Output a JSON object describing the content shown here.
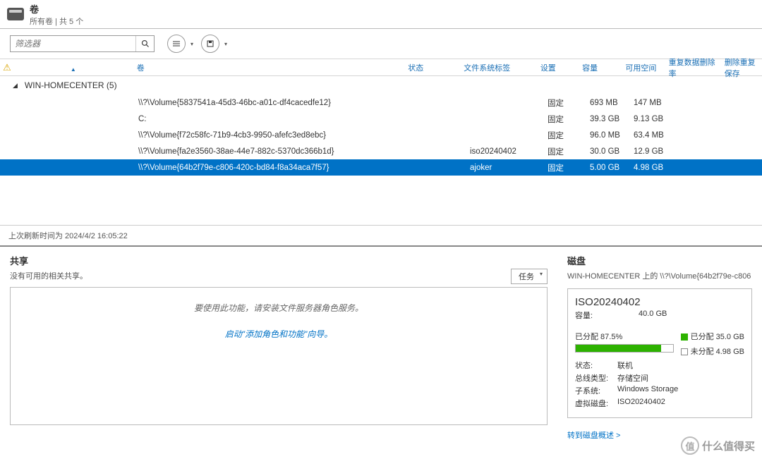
{
  "header": {
    "title": "卷",
    "subtitle": "所有卷 | 共 5 个"
  },
  "toolbar": {
    "filter_placeholder": "筛选器"
  },
  "columns": {
    "vol": "卷",
    "status": "状态",
    "fslabel": "文件系统标签",
    "setting": "设置",
    "capacity": "容量",
    "free": "可用空间",
    "dedup": "重复数据删除率",
    "dedupsave": "删除重复保存"
  },
  "group": {
    "name": "WIN-HOMECENTER (5)"
  },
  "rows": [
    {
      "vol": "\\\\?\\Volume{5837541a-45d3-46bc-a01c-df4cacedfe12}",
      "status": "",
      "fslabel": "",
      "setting": "固定",
      "cap": "693 MB",
      "free": "147 MB"
    },
    {
      "vol": "C:",
      "status": "",
      "fslabel": "",
      "setting": "固定",
      "cap": "39.3 GB",
      "free": "9.13 GB"
    },
    {
      "vol": "\\\\?\\Volume{f72c58fc-71b9-4cb3-9950-afefc3ed8ebc}",
      "status": "",
      "fslabel": "",
      "setting": "固定",
      "cap": "96.0 MB",
      "free": "63.4 MB"
    },
    {
      "vol": "\\\\?\\Volume{fa2e3560-38ae-44e7-882c-5370dc366b1d}",
      "status": "",
      "fslabel": "iso20240402",
      "setting": "固定",
      "cap": "30.0 GB",
      "free": "12.9 GB"
    },
    {
      "vol": "\\\\?\\Volume{64b2f79e-c806-420c-bd84-f8a34aca7f57}",
      "status": "",
      "fslabel": "ajoker",
      "setting": "固定",
      "cap": "5.00 GB",
      "free": "4.98 GB"
    }
  ],
  "footer": {
    "refresh_time": "上次刷新时间为 2024/4/2 16:05:22"
  },
  "share_panel": {
    "title": "共享",
    "subtitle": "没有可用的相关共享。",
    "task_btn": "任务",
    "message": "要使用此功能，请安装文件服务器角色服务。",
    "link": "启动\"添加角色和功能\"向导。"
  },
  "disk_panel": {
    "title": "磁盘",
    "path": "WIN-HOMECENTER 上的 \\\\?\\Volume{64b2f79e-c806",
    "name": "ISO20240402",
    "cap_label": "容量:",
    "cap_value": "40.0 GB",
    "alloc_label": "已分配 87.5%",
    "alloc_legend": "已分配 35.0 GB",
    "unalloc_legend": "未分配 4.98 GB",
    "status_label": "状态:",
    "status_value": "联机",
    "bus_label": "总线类型:",
    "bus_value": "存储空间",
    "sub_label": "子系统:",
    "sub_value": "Windows Storage",
    "vdisk_label": "虚拟磁盘:",
    "vdisk_value": "ISO20240402",
    "link": "转到磁盘概述 >"
  },
  "watermark": "什么值得买"
}
